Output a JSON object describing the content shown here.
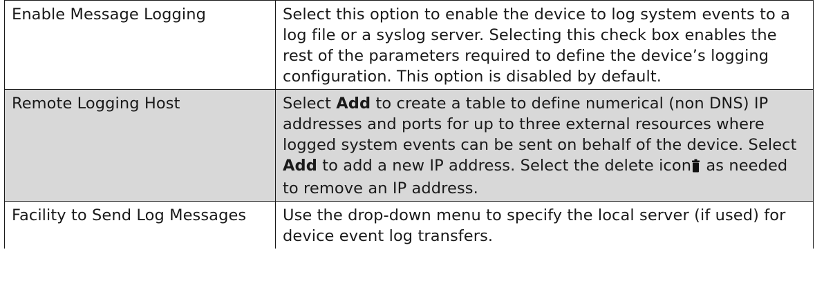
{
  "rows": [
    {
      "parameter": "Enable Message Logging",
      "description": "Select this option to enable the device to log system events to a log file or a syslog server. Selecting this check box enables the rest of the parameters required to define the device’s logging configuration. This option is disabled by default."
    },
    {
      "parameter": "Remote Logging Host",
      "description": {
        "part1": "Select ",
        "bold1": "Add",
        "part2": " to create a table to define numerical (non DNS) IP addresses and ports for up to three external resources where logged system events can be sent on behalf of the device. Select ",
        "bold2": "Add",
        "part3": " to add a new IP address. Select the delete icon",
        "icon": "trash-icon",
        "part4": " as needed to remove an IP address."
      }
    },
    {
      "parameter": "Facility to Send Log Messages",
      "description": "Use the drop-down menu to specify the local server (if used) for device event log transfers."
    }
  ]
}
